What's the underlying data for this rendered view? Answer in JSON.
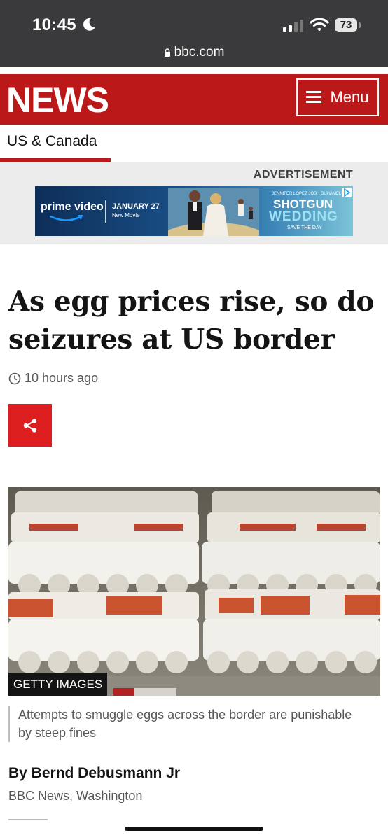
{
  "status_bar": {
    "time": "10:45",
    "battery": "73",
    "url": "bbc.com"
  },
  "header": {
    "logo": "NEWS",
    "menu_label": "Menu",
    "section": "US & Canada",
    "brand_color": "#bb1919"
  },
  "advert": {
    "label": "ADVERTISEMENT",
    "brand": "prime video",
    "date": "JANUARY 27",
    "subtitle": "New Movie",
    "credits": "JENNIFER LOPEZ   JOSH DUHAMEL",
    "title_line1": "SHOTGUN",
    "title_line2": "WEDDING",
    "tagline": "SAVE THE DAY"
  },
  "article": {
    "headline": "As egg prices rise, so do seizures at US border",
    "timestamp": "10 hours ago",
    "image_credit": "GETTY IMAGES",
    "caption": "Attempts to smuggle eggs across the border are punishable by steep fines",
    "byline": "By Bernd Debusmann Jr",
    "byline_org": "BBC News, Washington"
  },
  "icons": [
    "moon-icon",
    "signal-icon",
    "wifi-icon",
    "lock-icon",
    "hamburger-icon",
    "clock-icon",
    "share-icon"
  ]
}
